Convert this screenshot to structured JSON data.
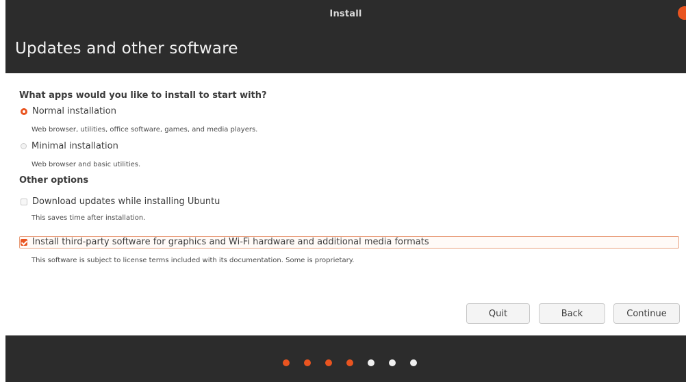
{
  "window": {
    "title": "Install"
  },
  "header": {
    "page_title": "Updates and other software"
  },
  "sections": {
    "apps_heading": "What apps would you like to install to start with?",
    "other_heading": "Other options"
  },
  "install_type": {
    "normal": {
      "label": "Normal installation",
      "description": "Web browser, utilities, office software, games, and media players.",
      "selected": true
    },
    "minimal": {
      "label": "Minimal installation",
      "description": "Web browser and basic utilities.",
      "selected": false
    }
  },
  "options": {
    "download_updates": {
      "label": "Download updates while installing Ubuntu",
      "description": "This saves time after installation.",
      "checked": false
    },
    "third_party": {
      "label": "Install third-party software for graphics and Wi-Fi hardware and additional media formats",
      "description": "This software is subject to license terms included with its documentation. Some is proprietary.",
      "checked": true
    }
  },
  "buttons": {
    "quit": "Quit",
    "back": "Back",
    "continue": "Continue"
  },
  "progress": {
    "total_steps": 7,
    "completed_steps": 4
  },
  "colors": {
    "accent": "#e95420",
    "dark_bg": "#2c2c2c",
    "panel_bg": "#ffffff"
  }
}
